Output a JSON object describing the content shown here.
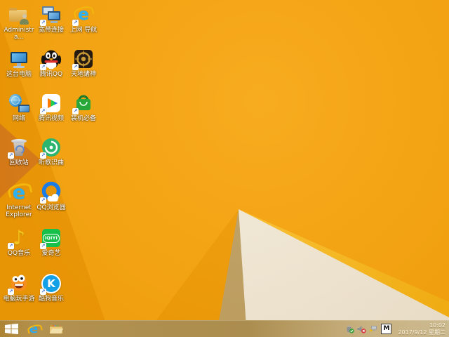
{
  "wallpaper": {
    "base_color": "#f7a50e",
    "facet_colors": [
      "#ee9905",
      "#d97c17",
      "#f09c05",
      "#bfa062",
      "#f2ebdb",
      "#ffc838"
    ]
  },
  "desktop": {
    "icons": [
      {
        "label": "Administra..."
      },
      {
        "label": "宽带连接"
      },
      {
        "label": "上网 导航"
      },
      {
        "label": "这台电脑"
      },
      {
        "label": "腾讯QQ"
      },
      {
        "label": "天地诸神"
      },
      {
        "label": "网络"
      },
      {
        "label": "腾讯视频"
      },
      {
        "label": "装机必备"
      },
      {
        "label": "回收站"
      },
      {
        "label": "听歌识曲"
      },
      {
        "label": "Internet Explorer"
      },
      {
        "label": "QQ浏览器"
      },
      {
        "label": "QQ音乐"
      },
      {
        "label": "爱奇艺"
      },
      {
        "label": "电脑玩手游"
      },
      {
        "label": "酷狗音乐"
      }
    ]
  },
  "taskbar": {
    "buttons": [
      "start",
      "internet-explorer",
      "file-explorer"
    ]
  },
  "tray": {
    "time": "10:02",
    "date": "2017/9/12 星期二",
    "input_method": "M"
  },
  "glyphs": {
    "ie": "e",
    "music_note": "♪",
    "kugou": "K",
    "iqiyi": "iQIYI",
    "shortcut_arrow": "↗"
  }
}
